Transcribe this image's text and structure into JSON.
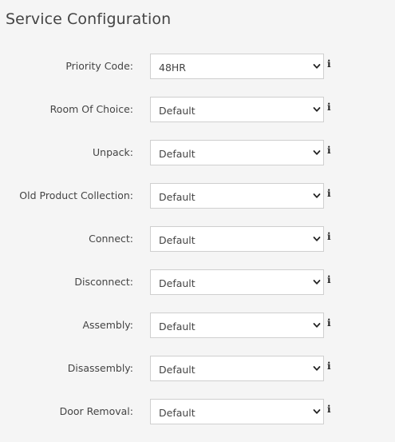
{
  "page": {
    "title": "Service Configuration"
  },
  "fields": [
    {
      "label": "Priority Code:",
      "value": "48HR",
      "name": "priority-code"
    },
    {
      "label": "Room Of Choice:",
      "value": "Default",
      "name": "room-of-choice"
    },
    {
      "label": "Unpack:",
      "value": "Default",
      "name": "unpack"
    },
    {
      "label": "Old Product Collection:",
      "value": "Default",
      "name": "old-product-collection"
    },
    {
      "label": "Connect:",
      "value": "Default",
      "name": "connect"
    },
    {
      "label": "Disconnect:",
      "value": "Default",
      "name": "disconnect"
    },
    {
      "label": "Assembly:",
      "value": "Default",
      "name": "assembly"
    },
    {
      "label": "Disassembly:",
      "value": "Default",
      "name": "disassembly"
    },
    {
      "label": "Door Removal:",
      "value": "Default",
      "name": "door-removal"
    }
  ],
  "icons": {
    "info": "i",
    "info_name": "info-icon",
    "dropdown_name": "chevron-down-icon"
  },
  "colors": {
    "background": "#f5f5f5",
    "border": "#cfcfcf",
    "text": "#444444"
  }
}
